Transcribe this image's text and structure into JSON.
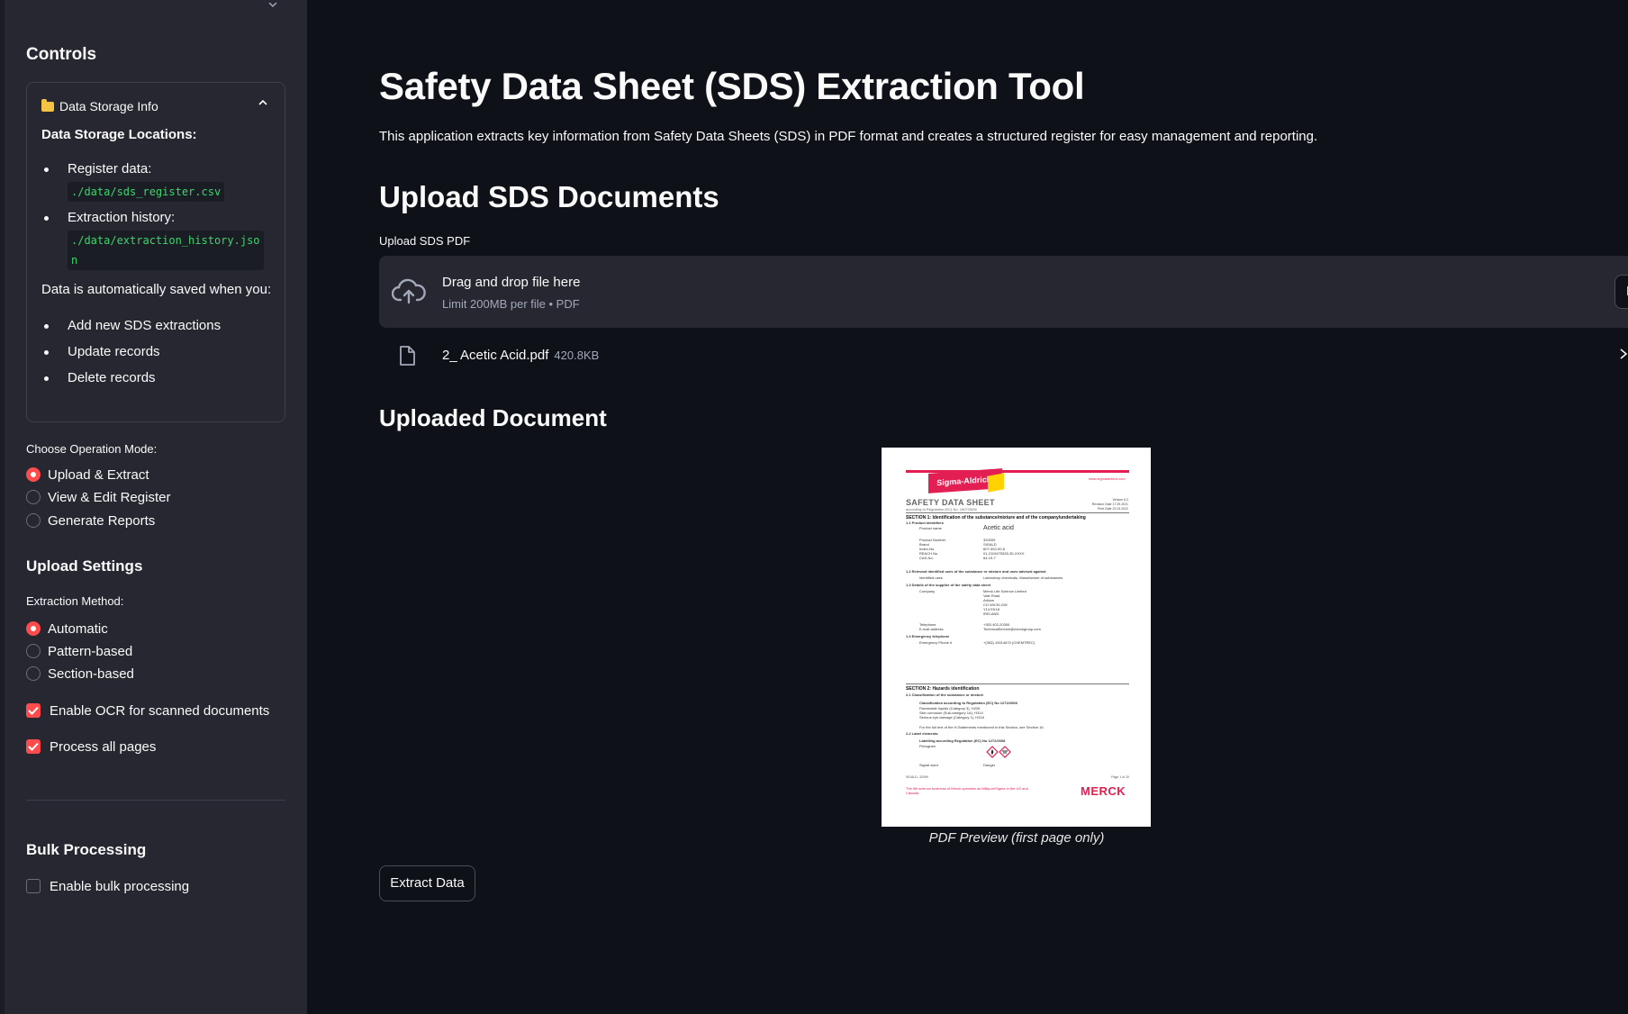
{
  "sidebar": {
    "title": "Controls",
    "storage_expander": {
      "title": "Data Storage Info",
      "heading": "Data Storage Locations:",
      "locations": [
        {
          "label": "Register data:",
          "path": "./data/sds_register.csv"
        },
        {
          "label": "Extraction history:",
          "path": "./data/extraction_history.json"
        }
      ],
      "auto_save_text": "Data is automatically saved when you:",
      "auto_save_items": [
        "Add new SDS extractions",
        "Update records",
        "Delete records"
      ]
    },
    "operation_mode": {
      "label": "Choose Operation Mode:",
      "options": [
        "Upload & Extract",
        "View & Edit Register",
        "Generate Reports"
      ],
      "selected": "Upload & Extract"
    },
    "upload_settings": {
      "title": "Upload Settings",
      "method_label": "Extraction Method:",
      "methods": [
        "Automatic",
        "Pattern-based",
        "Section-based"
      ],
      "selected": "Automatic",
      "ocr_label": "Enable OCR for scanned documents",
      "ocr_checked": true,
      "all_pages_label": "Process all pages",
      "all_pages_checked": true
    },
    "bulk": {
      "title": "Bulk Processing",
      "enable_label": "Enable bulk processing",
      "enabled": false
    }
  },
  "main": {
    "title": "Safety Data Sheet (SDS) Extraction Tool",
    "description": "This application extracts key information from Safety Data Sheets (SDS) in PDF format and creates a structured register for easy management and reporting.",
    "upload_heading": "Upload SDS Documents",
    "uploader": {
      "label": "Upload SDS PDF",
      "drop_text": "Drag and drop file here",
      "limit_text": "Limit 200MB per file • PDF",
      "browse_label": "Browse files"
    },
    "file": {
      "name": "2_ Acetic Acid.pdf",
      "size": "420.8KB"
    },
    "uploaded_heading": "Uploaded Document",
    "preview_caption": "PDF Preview (first page only)",
    "extract_button": "Extract Data"
  },
  "pdf": {
    "brand": "Sigma-Aldrich.",
    "url": "www.sigmaaldrich.com",
    "doc_title": "SAFETY DATA SHEET",
    "doc_sub": "according to Regulation (EC) No. 1907/2006",
    "version": "Version 6.3",
    "revision": "Revision Date 17.09.2021",
    "print_date": "Print Date 22.04.2022",
    "section1": "SECTION 1: Identification of the substance/mixture and of the company/undertaking",
    "s11": "1.1    Product identifiers",
    "product_name_label": "Product name",
    "product_name": "Acetic acid",
    "id_labels": [
      "Product Number",
      "Brand",
      "Index-No.",
      "REACH No.",
      "CAS-No."
    ],
    "id_values": [
      "320099",
      "SIGALD",
      "607-002-00-6",
      "01-2119475328-30-XXXX",
      "64-19-7"
    ],
    "s12": "1.2    Relevant identified uses of the substance or mixture and uses advised against",
    "uses_label": "Identified uses",
    "uses_value": "Laboratory chemicals, Manufacture of substances",
    "s13": "1.3    Details of the supplier of the safety data sheet",
    "company_label": "Company",
    "company_lines": [
      "Merck Life Science Limited",
      "Vale Road",
      "Arklow",
      "CO WICKLOW",
      "Y14 EK18",
      "IRELAND"
    ],
    "phone_label": "Telephone",
    "phone": "+353 402-20300",
    "email_label": "E-mail address",
    "email": "TechnicalService@merckgroup.com",
    "s14": "1.4    Emergency telephone",
    "emergency_label": "Emergency Phone #",
    "emergency": "+(353)-19014670 (CHEMTREC)",
    "section2": "SECTION 2: Hazards identification",
    "s21": "2.1    Classification of the substance or mixture",
    "class_head": "Classification according to Regulation (EC) No 1272/2008",
    "class_lines": [
      "Flammable liquids (Category 3), H226",
      "Skin corrosion (Sub-category 1A), H314",
      "Serious eye damage (Category 1), H318"
    ],
    "class_note": "For the full text of the H-Statements mentioned in this Section, see Section 16.",
    "s22": "2.2    Label elements",
    "label_head": "Labelling according Regulation (EC) No 1272/2008",
    "pictogram_label": "Pictogram",
    "signal_label": "Signal word",
    "signal_value": "Danger",
    "footer_left": "SIGALD- 32099",
    "footer_right": "Page 1  of  10",
    "footer_pink": "The life science business of Merck operates as MilliporeSigma in the US and Canada.",
    "merck_logo": "MERCK"
  },
  "colors": {
    "accent": "#ff4b4b",
    "sidebar_bg": "#262730",
    "main_bg": "#0e1117",
    "code_green": "#3dd56d"
  }
}
